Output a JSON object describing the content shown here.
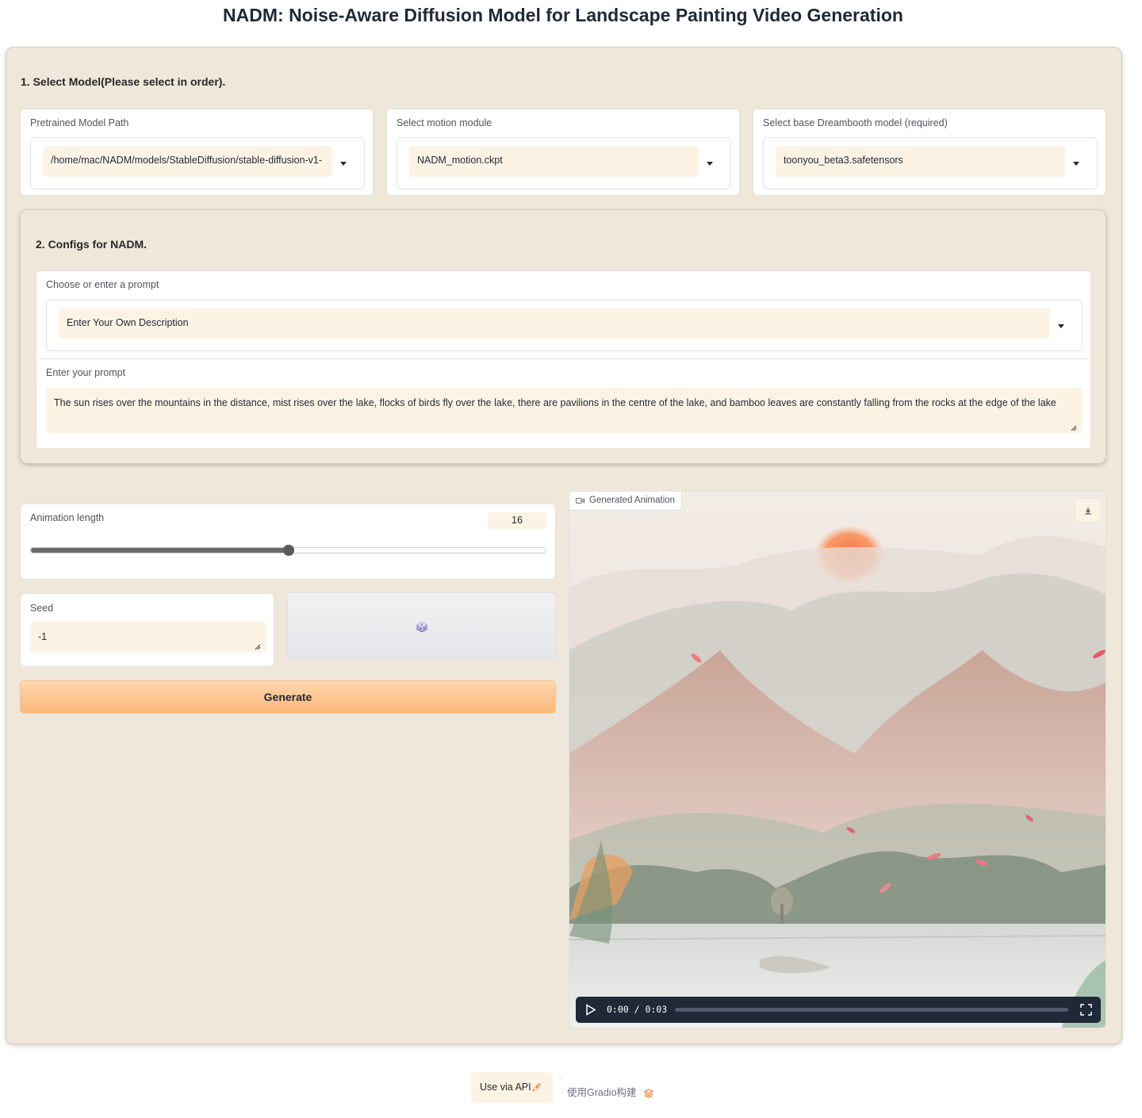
{
  "page_title": "NADM: Noise-Aware Diffusion Model for Landscape Painting Video Generation",
  "section1": {
    "heading": "1. Select Model(Please select in order).",
    "pretrained": {
      "label": "Pretrained Model Path",
      "value": "/home/mac/NADM/models/StableDiffusion/stable-diffusion-v1-"
    },
    "motion": {
      "label": "Select motion module",
      "value": "NADM_motion.ckpt"
    },
    "dreambooth": {
      "label": "Select base Dreambooth model (required)",
      "value": "toonyou_beta3.safetensors"
    }
  },
  "section2": {
    "heading": "2. Configs for NADM.",
    "prompt_choice": {
      "label": "Choose or enter a prompt",
      "value": "Enter Your Own Description"
    },
    "prompt": {
      "label": "Enter your prompt",
      "value": "The sun rises over the mountains in the distance, mist rises over the lake, flocks of birds fly over the lake, there are pavilions in the centre of the lake, and bamboo leaves are constantly falling from the rocks at the edge of the lake"
    }
  },
  "animation_length": {
    "label": "Animation length",
    "value": "16",
    "fraction": 0.5
  },
  "seed": {
    "label": "Seed",
    "value": "-1"
  },
  "random_seed_icon": "dice-icon",
  "generate_label": "Generate",
  "output": {
    "label": "Generated Animation",
    "time": "0:00 / 0:03",
    "progress": 0
  },
  "footer": {
    "api_label": "Use via API",
    "built_with": "使用Gradio构建"
  },
  "colors": {
    "background": "#efe7da",
    "input_fill": "#fdf3e5",
    "accent": "#fcb878"
  }
}
